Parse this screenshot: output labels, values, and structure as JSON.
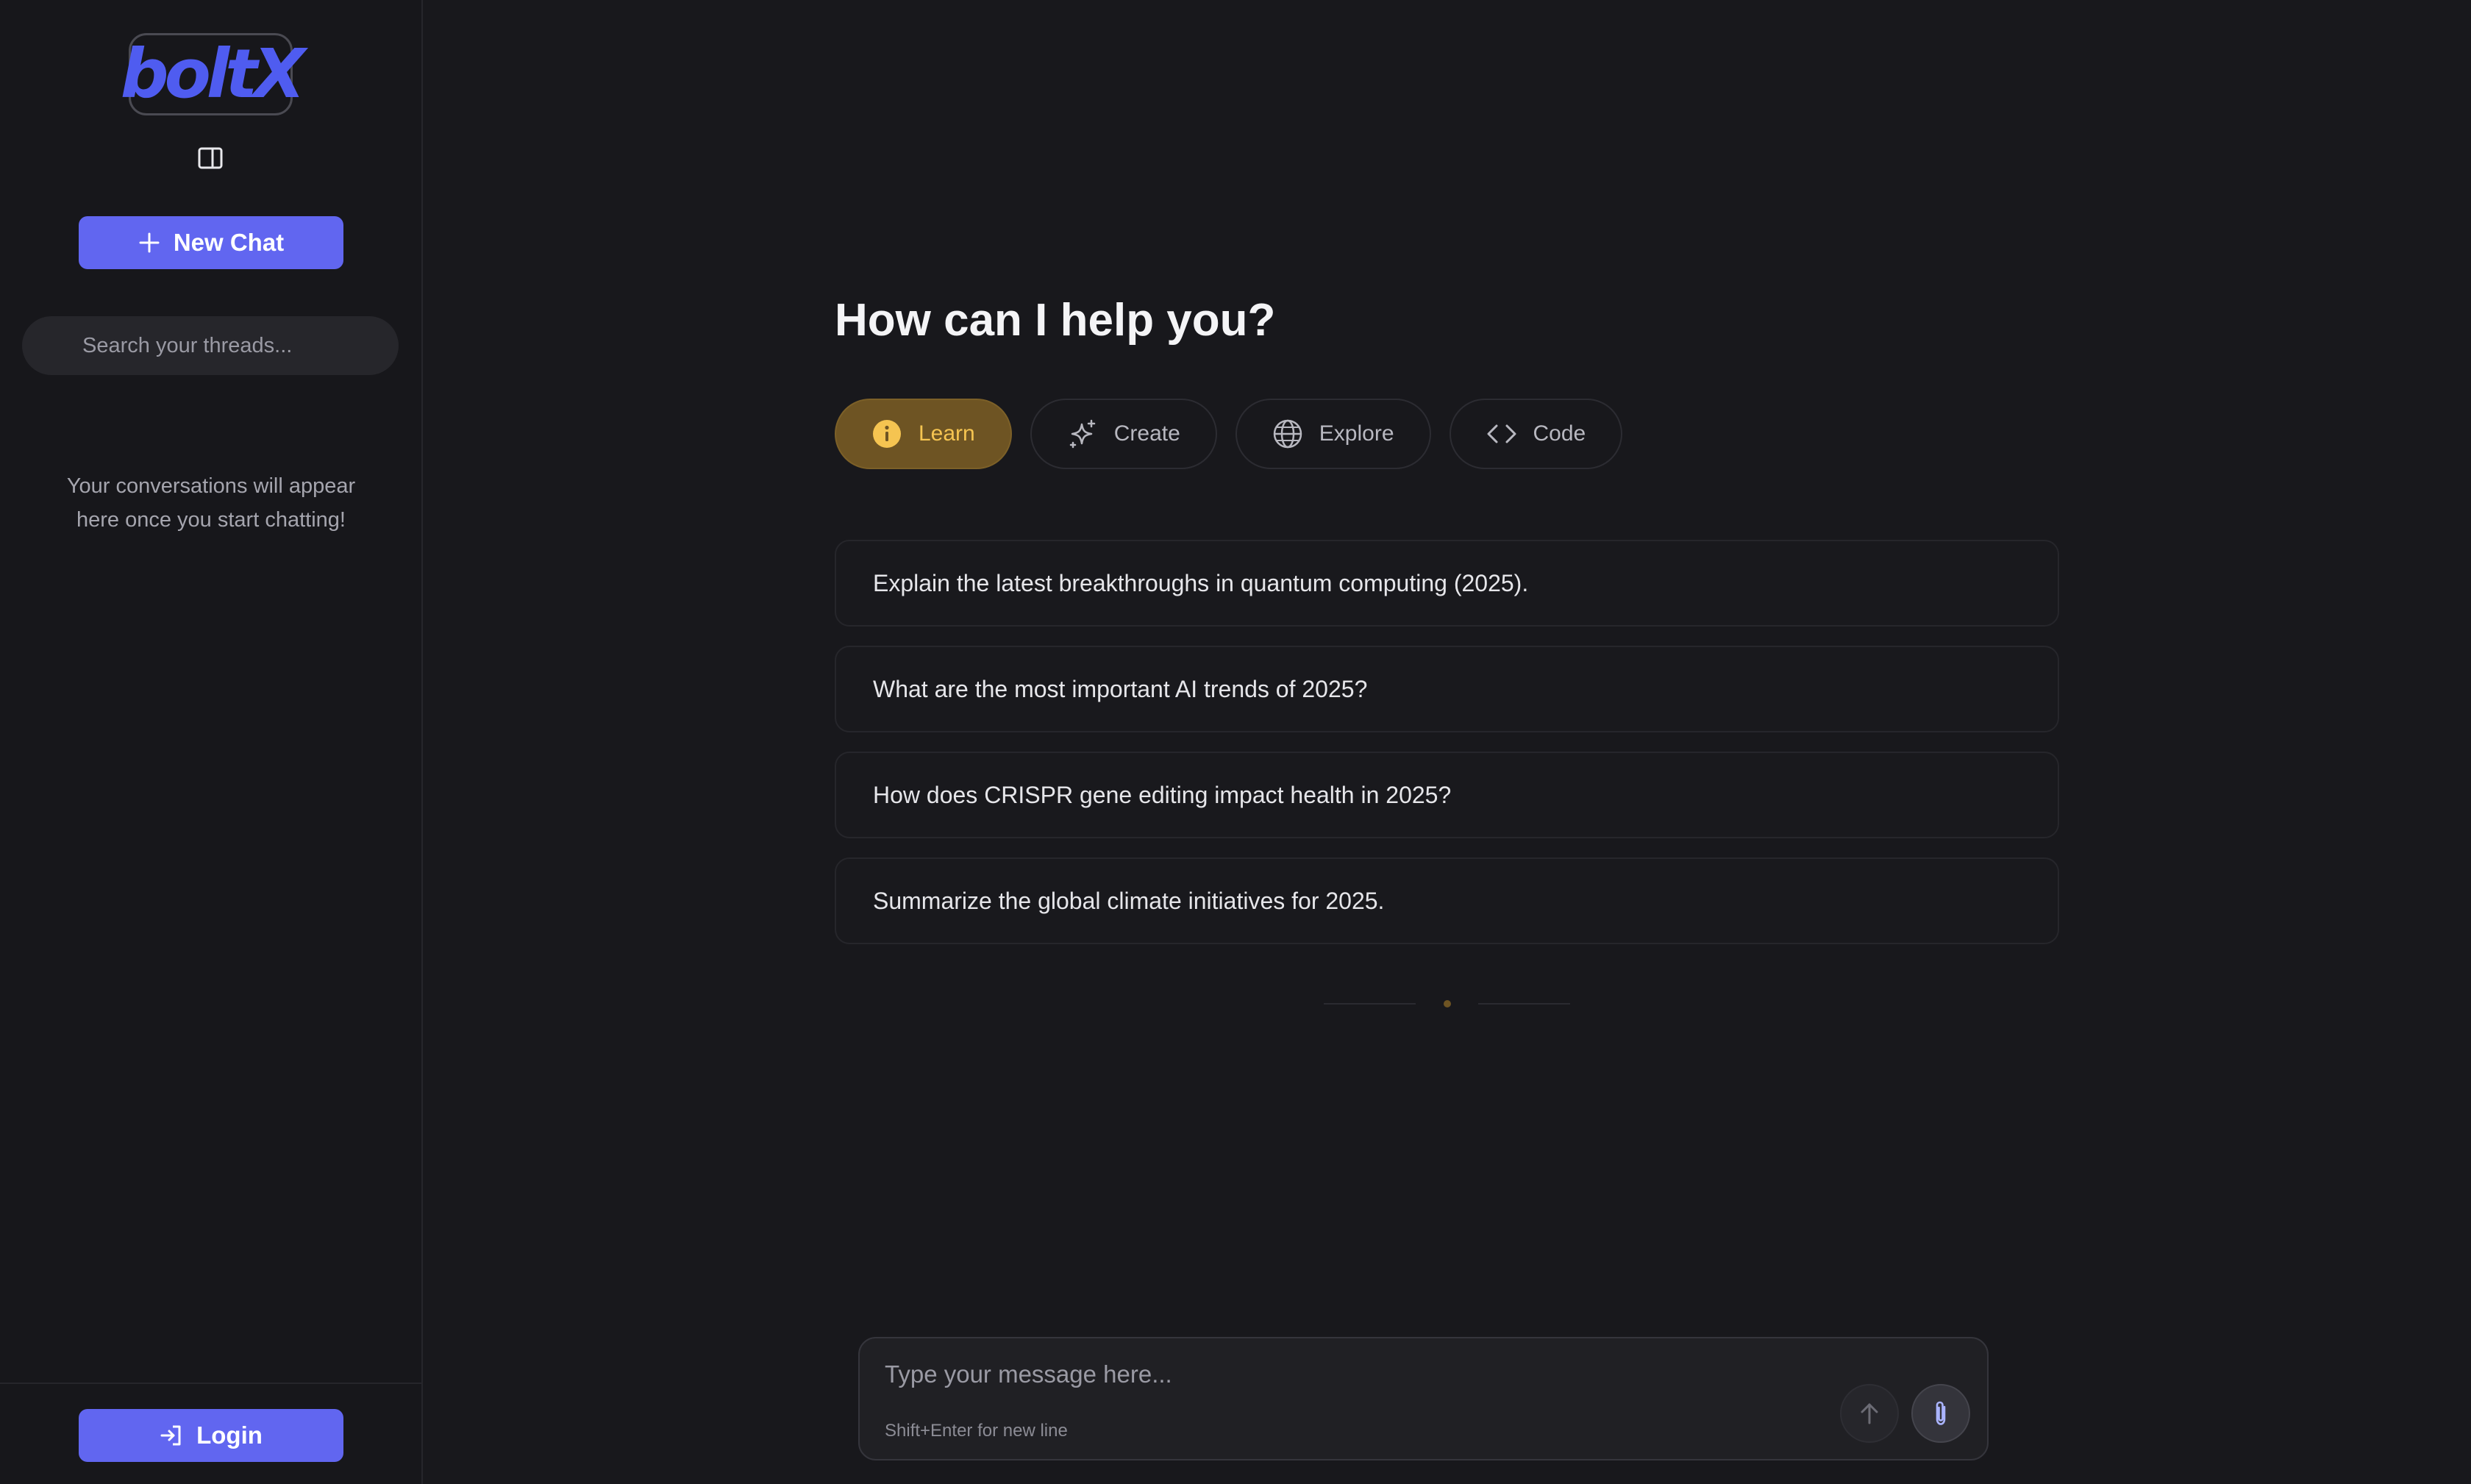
{
  "sidebar": {
    "logo_text": "boltX",
    "new_chat_label": "New Chat",
    "search_placeholder": "Search your threads...",
    "empty_message": "Your conversations will appear here once you start chatting!",
    "login_label": "Login"
  },
  "main": {
    "title": "How can I help you?",
    "categories": [
      {
        "label": "Learn",
        "icon": "info-circle-icon",
        "active": true
      },
      {
        "label": "Create",
        "icon": "sparkles-icon",
        "active": false
      },
      {
        "label": "Explore",
        "icon": "globe-icon",
        "active": false
      },
      {
        "label": "Code",
        "icon": "code-icon",
        "active": false
      }
    ],
    "suggestions": [
      "Explain the latest breakthroughs in quantum computing (2025).",
      "What are the most important AI trends of 2025?",
      "How does CRISPR gene editing impact health in 2025?",
      "Summarize the global climate initiatives for 2025."
    ]
  },
  "composer": {
    "placeholder": "Type your message here...",
    "hint": "Shift+Enter for new line"
  },
  "colors": {
    "accent": "#6166f0",
    "logo": "#4f5cf0",
    "active_category_bg": "#6e5423",
    "active_category_text": "#f5c451",
    "background": "#18181c"
  }
}
